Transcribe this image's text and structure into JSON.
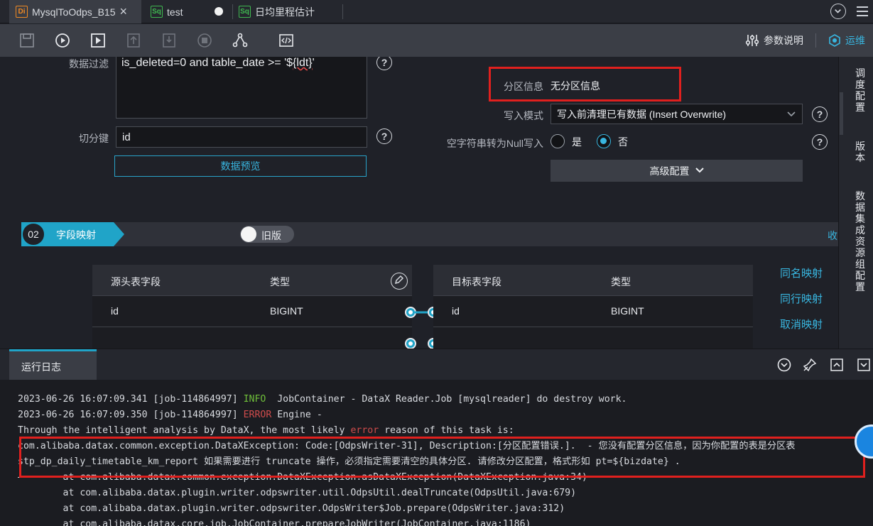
{
  "tabs": [
    {
      "badge": "Di",
      "label": "MysqlToOdps_B15",
      "close": "×",
      "active": true
    },
    {
      "badge": "Sq",
      "label": "test",
      "active": false
    },
    {
      "badge": "Sq",
      "label": "日均里程估计",
      "active": false
    }
  ],
  "toolbar": {
    "params_label": "参数说明",
    "ops_label": "运维"
  },
  "reader": {
    "filter_label": "数据过滤",
    "filter_value_prefix": "is_deleted=0 and table_date >= '$",
    "filter_value_var": "{ldt}",
    "filter_value_suffix": "'",
    "split_label": "切分键",
    "split_value": "id",
    "preview_button": "数据预览"
  },
  "writer": {
    "partition_label": "分区信息",
    "partition_value": "无分区信息",
    "write_mode_label": "写入模式",
    "write_mode_value": "写入前清理已有数据 (Insert Overwrite)",
    "null_label": "空字符串转为Null写入",
    "radio_yes": "是",
    "radio_no": "否",
    "selected": "否",
    "advanced_button": "高级配置"
  },
  "step": {
    "number": "02",
    "title": "字段映射",
    "toggle_label": "旧版",
    "collapse_label": "收"
  },
  "source_table": {
    "headers": [
      "源头表字段",
      "类型"
    ],
    "rows": [
      [
        "id",
        "BIGINT"
      ]
    ]
  },
  "target_table": {
    "headers": [
      "目标表字段",
      "类型"
    ],
    "rows": [
      [
        "id",
        "BIGINT"
      ]
    ]
  },
  "mapping_actions": [
    "同名映射",
    "同行映射",
    "取消映射"
  ],
  "right_sidebar": [
    "调度配置",
    "版本",
    "数据集成资源组配置"
  ],
  "log": {
    "title": "运行日志",
    "lines": [
      {
        "pre": "2023-06-26 16:07:09.341 [job-114864997] ",
        "level": "INFO",
        "post": "  JobContainer - DataX Reader.Job [mysqlreader] do destroy work."
      },
      {
        "pre": "2023-06-26 16:07:09.350 [job-114864997] ",
        "level": "ERROR",
        "post": " Engine -"
      },
      {
        "pre": "Through the intelligent analysis by DataX, the most likely ",
        "level": "error",
        "post": " reason of this task is:"
      },
      {
        "text": "com.alibaba.datax.common.exception.DataXException: Code:[OdpsWriter-31], Description:[分区配置错误.].  - 您没有配置分区信息，因为你配置的表是分区表"
      },
      {
        "text": "stp_dp_daily_timetable_km_report 如果需要进行 truncate 操作，必须指定需要清空的具体分区. 请修改分区配置，格式形如 pt=${bizdate} ."
      },
      {
        "text": "        at com.alibaba.datax.common.exception.DataXException.asDataXException(DataXException.java:34)"
      },
      {
        "text": "        at com.alibaba.datax.plugin.writer.odpswriter.util.OdpsUtil.dealTruncate(OdpsUtil.java:679)"
      },
      {
        "text": "        at com.alibaba.datax.plugin.writer.odpswriter.OdpsWriter$Job.prepare(OdpsWriter.java:312)"
      },
      {
        "text": "        at com.alibaba.datax.core.job.JobContainer.prepareJobWriter(JobContainer.java:1186)"
      }
    ]
  }
}
